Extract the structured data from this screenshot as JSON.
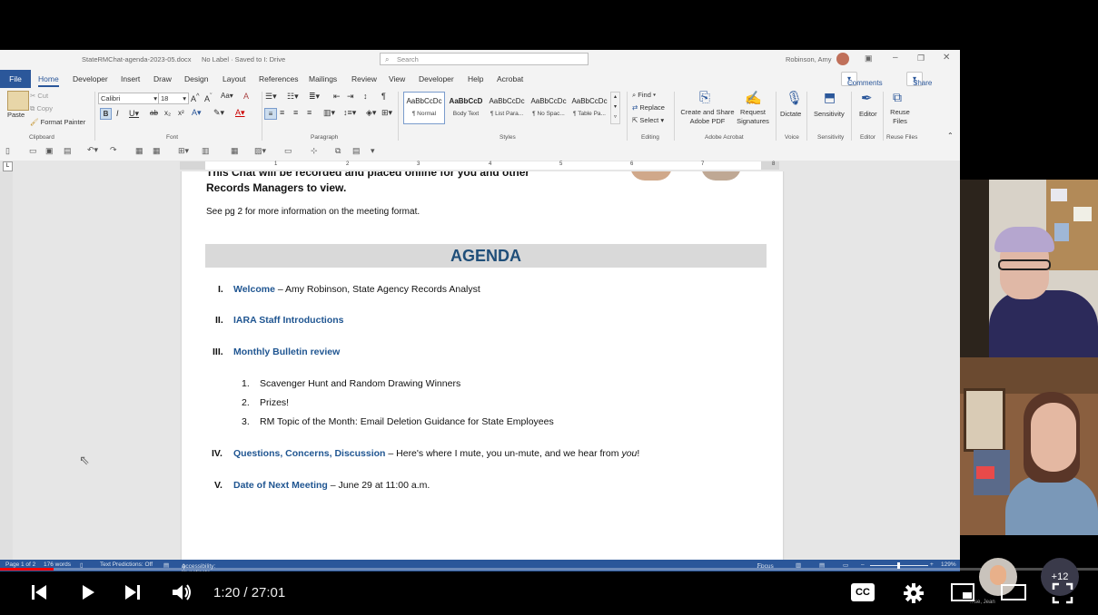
{
  "titlebar": {
    "filename": "StateRMChat-agenda-2023-05.docx",
    "label_status": "No Label · Saved to I: Drive",
    "search_placeholder": "Search",
    "user": "Robinson, Amy"
  },
  "menu": {
    "tabs": [
      "File",
      "Home",
      "Developer",
      "Insert",
      "Draw",
      "Design",
      "Layout",
      "References",
      "Mailings",
      "Review",
      "View",
      "Developer",
      "Help",
      "Acrobat"
    ],
    "comments": "Comments",
    "share": "Share"
  },
  "ribbon": {
    "paste": "Paste",
    "cut": "Cut",
    "copy": "Copy",
    "format_painter": "Format Painter",
    "font_name": "Calibri",
    "font_size": "18",
    "groups": {
      "clipboard": "Clipboard",
      "font": "Font",
      "paragraph": "Paragraph",
      "styles": "Styles",
      "editing": "Editing",
      "acrobat": "Adobe Acrobat",
      "voice": "Voice",
      "sensitivity": "Sensitivity",
      "editor": "Editor",
      "reuse": "Reuse Files"
    },
    "styles": [
      {
        "sample": "AaBbCcDc",
        "name": "¶ Normal"
      },
      {
        "sample": "AaBbCcD",
        "name": "Body Text"
      },
      {
        "sample": "AaBbCcDc",
        "name": "¶ List Para..."
      },
      {
        "sample": "AaBbCcDc",
        "name": "¶ No Spac..."
      },
      {
        "sample": "AaBbCcDc",
        "name": "¶ Table Pa..."
      }
    ],
    "find": "Find",
    "replace": "Replace",
    "select": "Select",
    "create_share_pdf_1": "Create and Share",
    "create_share_pdf_2": "Adobe PDF",
    "request_sig_1": "Request",
    "request_sig_2": "Signatures",
    "dictate": "Dictate",
    "sensitivity": "Sensitivity",
    "editor": "Editor",
    "reuse_1": "Reuse",
    "reuse_2": "Files"
  },
  "ruler": [
    "1",
    "2",
    "3",
    "4",
    "5",
    "6",
    "7",
    "8"
  ],
  "document": {
    "intro_line1": "This Chat will be recorded and placed online for you and other",
    "intro_line2": "Records Managers to view.",
    "see_pg": "See pg 2 for more information on the meeting format.",
    "agenda_title": "AGENDA",
    "items": [
      {
        "num": "I.",
        "title": "Welcome",
        "rest": " – Amy Robinson, State Agency Records Analyst"
      },
      {
        "num": "II.",
        "title": "IARA Staff Introductions",
        "rest": ""
      },
      {
        "num": "III.",
        "title": "Monthly Bulletin review",
        "rest": ""
      },
      {
        "num": "IV.",
        "title": "Questions, Concerns, Discussion",
        "rest": " –  Here's where I mute, you un-mute, and we hear from ",
        "rest_italic": "you",
        "rest_end": "!"
      },
      {
        "num": "V.",
        "title": "Date of Next Meeting",
        "rest": " – June 29 at 11:00 a.m."
      }
    ],
    "subitems": [
      {
        "num": "1.",
        "text": "Scavenger Hunt and Random Drawing Winners"
      },
      {
        "num": "2.",
        "text": "Prizes!"
      },
      {
        "num": "3.",
        "text": "RM Topic of the Month: Email Deletion Guidance for State Employees"
      }
    ]
  },
  "statusbar": {
    "page": "Page 1 of 2",
    "words": "176 words",
    "predictions": "Text Predictions: Off",
    "accessibility": "Accessibility: Investigate",
    "focus": "Focus",
    "zoom": "129%"
  },
  "participants": {
    "more_count": "+12",
    "name_partial": "...se, Jean"
  },
  "player": {
    "time": "1:20 / 27:01",
    "progress_fraction": 0.049,
    "accent": "#ff0000"
  }
}
